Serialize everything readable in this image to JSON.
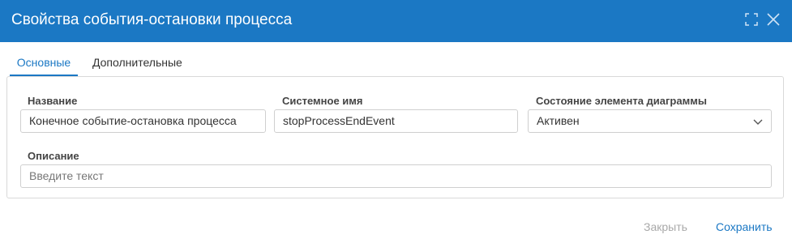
{
  "dialog": {
    "title": "Свойства события-остановки процесса"
  },
  "tabs": [
    {
      "label": "Основные",
      "active": true
    },
    {
      "label": "Дополнительные",
      "active": false
    }
  ],
  "form": {
    "name": {
      "label": "Название",
      "value": "Конечное событие-остановка процесса"
    },
    "system_name": {
      "label": "Системное имя",
      "value": "stopProcessEndEvent"
    },
    "state": {
      "label": "Состояние элемента диаграммы",
      "value": "Активен"
    },
    "description": {
      "label": "Описание",
      "value": "",
      "placeholder": "Введите текст"
    }
  },
  "footer": {
    "close_label": "Закрыть",
    "save_label": "Сохранить"
  },
  "colors": {
    "accent": "#1b78c4",
    "disabled_text": "#a9a9a9"
  },
  "icons": {
    "expand": "expand-icon",
    "close": "close-icon",
    "dropdown": "chevron-down-icon"
  }
}
